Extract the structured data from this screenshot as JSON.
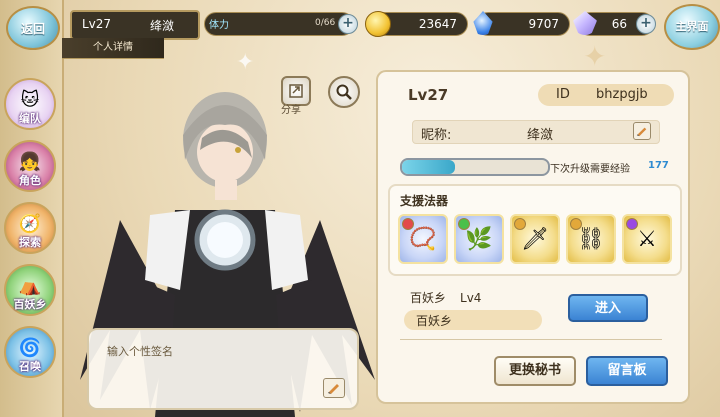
{
  "header": {
    "back_label": "返回",
    "level": "Lv27",
    "player_name": "绛潋",
    "sub_tab": "个人详情",
    "stamina_label": "体力",
    "stamina_value": "0/66",
    "gold": "23647",
    "gems": "9707",
    "crystals": "66",
    "home_label": "主界面"
  },
  "nav": {
    "items": [
      {
        "label": "编队",
        "icon": "team-icon"
      },
      {
        "label": "角色",
        "icon": "character-icon"
      },
      {
        "label": "探索",
        "icon": "explore-icon"
      },
      {
        "label": "百妖乡",
        "icon": "village-icon"
      },
      {
        "label": "召唤",
        "icon": "summon-icon"
      }
    ]
  },
  "character_area": {
    "share_label": "分享",
    "signature_placeholder": "输入个性签名"
  },
  "profile": {
    "level": "Lv27",
    "id_label": "ID",
    "id_value": "bhzpgjb",
    "nickname_label": "昵称:",
    "nickname": "绛潋",
    "xp_progress": 0.36,
    "xp_note": "下次升级需要经验",
    "xp_needed": "177",
    "support_title": "支援法器",
    "support_items": [
      {
        "icon": "bell-necklace-icon",
        "frame": "blue",
        "star_color": "#e24a4a"
      },
      {
        "icon": "leaf-charm-icon",
        "frame": "blue",
        "star_color": "#4ac04a"
      },
      {
        "icon": "dagger-icon",
        "frame": "gold",
        "star_color": "#e2a83a"
      },
      {
        "icon": "chain-ring-icon",
        "frame": "gold",
        "star_color": "#e2a83a"
      },
      {
        "icon": "twin-blade-icon",
        "frame": "gold",
        "star_color": "#9a4ae2"
      }
    ],
    "realm_name": "百妖乡",
    "realm_level": "Lv4",
    "realm_pill": "百妖乡",
    "enter_label": "进入",
    "secretary_label": "更换秘书",
    "board_label": "留言板"
  },
  "colors": {
    "accent_blue": "#3b83d3",
    "xp_fill": "#3aa7c9",
    "panel_bg": "#fbf6ec"
  }
}
